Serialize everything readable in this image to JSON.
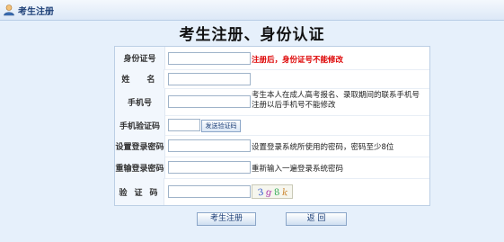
{
  "topbar": {
    "title": "考生注册",
    "icon": "user-icon"
  },
  "page": {
    "title": "考生注册、身份认证"
  },
  "form": {
    "id_label": "身份证号",
    "id_value": "",
    "id_hint": "注册后，身份证号不能修改",
    "name_label": "姓 名",
    "name_value": "",
    "phone_label": "手机号",
    "phone_value": "",
    "phone_hint_1": "考生本人在成人高考报名、录取期间的联系手机号",
    "phone_hint_2": "注册以后手机号不能修改",
    "sms_label": "手机验证码",
    "sms_value": "",
    "send_code": "发送验证码",
    "pwd_label": "设置登录密码",
    "pwd_value": "",
    "pwd_hint": "设置登录系统所使用的密码，密码至少8位",
    "pwd2_label": "重输登录密码",
    "pwd2_value": "",
    "pwd2_hint": "重新输入一遍登录系统密码",
    "captcha_label": "验证码",
    "captcha_value": "",
    "captcha_text": "3 g 8 k"
  },
  "buttons": {
    "register": "考生注册",
    "back": "返 回"
  },
  "colors": {
    "accent": "#1d3f77",
    "warning": "#dd0000",
    "background": "#e6f0fb"
  }
}
